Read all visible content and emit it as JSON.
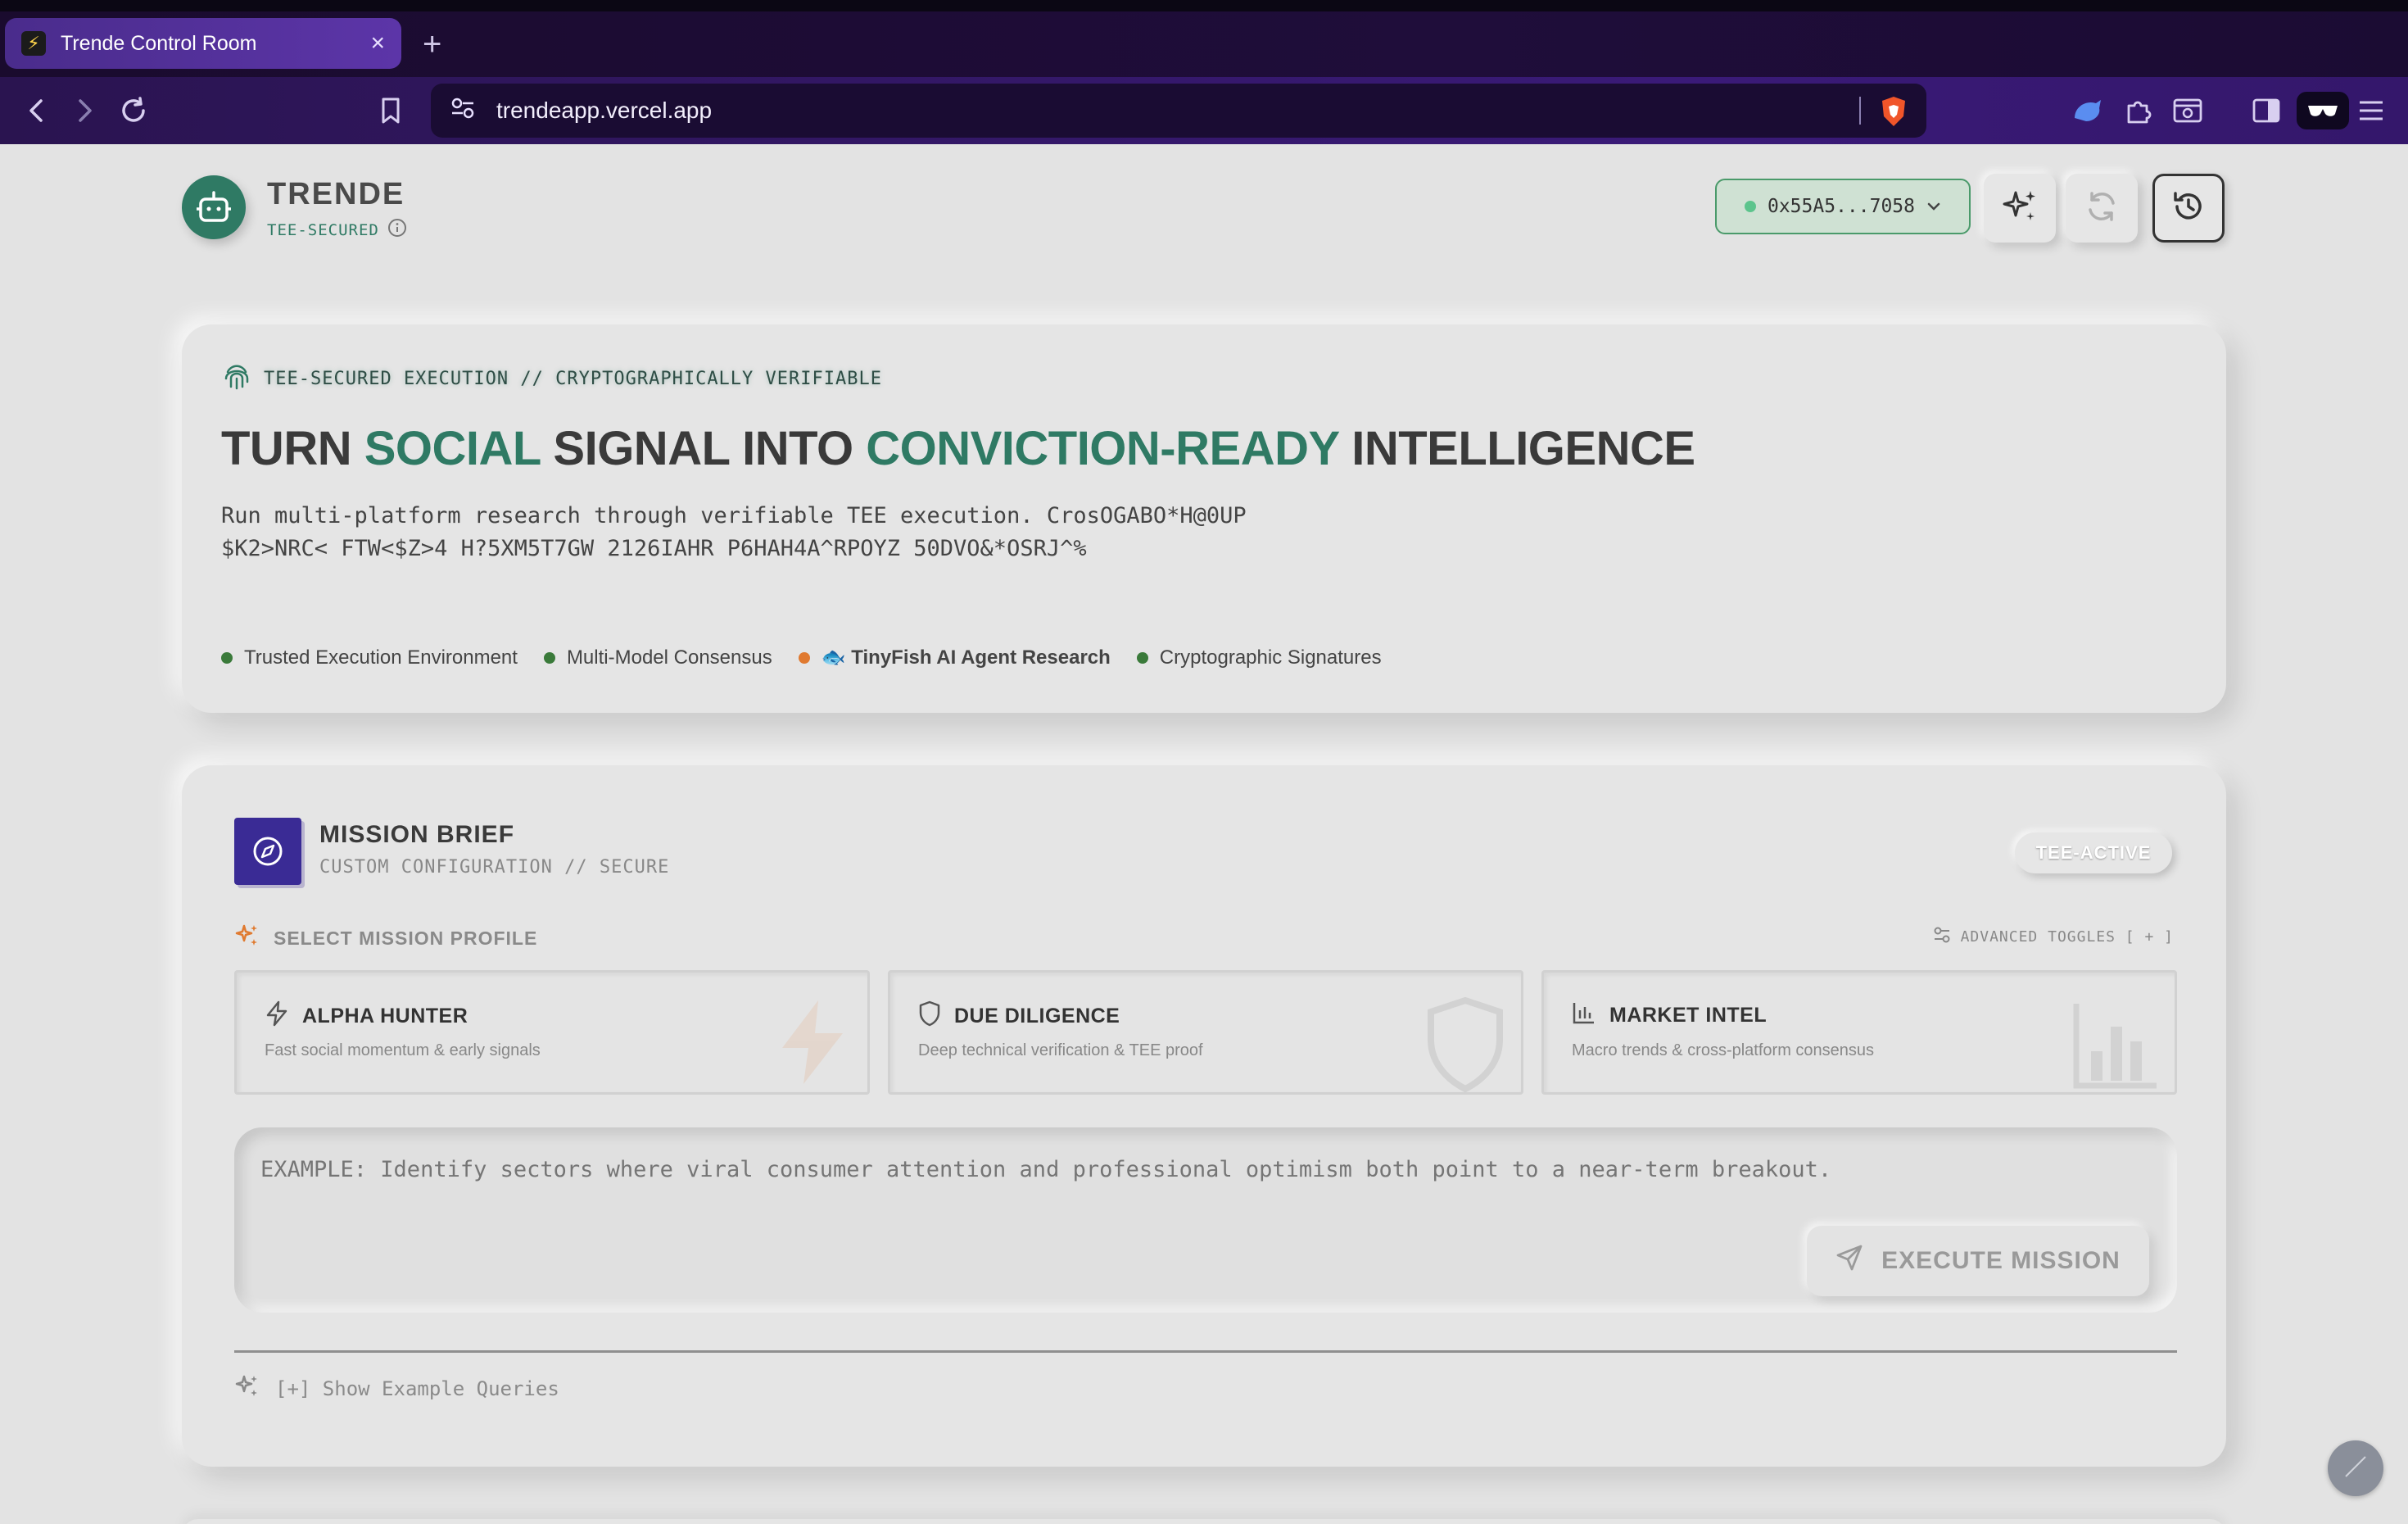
{
  "browser": {
    "tab_title": "Trende Control Room",
    "tab_close": "×",
    "new_tab": "+",
    "url": "trendeapp.vercel.app"
  },
  "header": {
    "brand_name": "TRENDE",
    "brand_sub": "TEE-SECURED",
    "wallet": "0x55A5...7058"
  },
  "hero": {
    "eyebrow": "TEE-SECURED EXECUTION // CRYPTOGRAPHICALLY VERIFIABLE",
    "headline": {
      "part1": "TURN ",
      "accent1": "SOCIAL",
      "part2": " SIGNAL INTO ",
      "accent2": "CONVICTION-READY",
      "part3": " INTELLIGENCE"
    },
    "description_line1": "Run multi-platform research through verifiable TEE execution. CrosOGABO*H@0UP",
    "description_line2": "$K2>NRC< FTW<$Z>4 H?5XM5T7GW 2126IAHR P6HAH4A^RPOYZ 50DVO&*OSRJ^%",
    "features": [
      "Trusted Execution Environment",
      "Multi-Model Consensus",
      "🐟 TinyFish AI Agent Research",
      "Cryptographic Signatures"
    ]
  },
  "mission": {
    "title": "MISSION BRIEF",
    "subtitle": "CUSTOM CONFIGURATION // SECURE",
    "badge": "TEE-ACTIVE",
    "select_label": "SELECT MISSION PROFILE",
    "advanced": "ADVANCED TOGGLES [ + ]",
    "profiles": [
      {
        "title": "ALPHA HUNTER",
        "desc": "Fast social momentum & early signals"
      },
      {
        "title": "DUE DILIGENCE",
        "desc": "Deep technical verification & TEE proof"
      },
      {
        "title": "MARKET INTEL",
        "desc": "Macro trends & cross-platform consensus"
      }
    ],
    "query_placeholder": "EXAMPLE: Identify sectors where viral consumer attention and professional optimism both point to a near-term breakout.",
    "execute_label": "EXECUTE MISSION",
    "examples_label": "[+] Show Example Queries"
  },
  "colors": {
    "accent": "#2f7a64",
    "brand_purple": "#3a2b95",
    "warning_dot": "#e07a30"
  }
}
